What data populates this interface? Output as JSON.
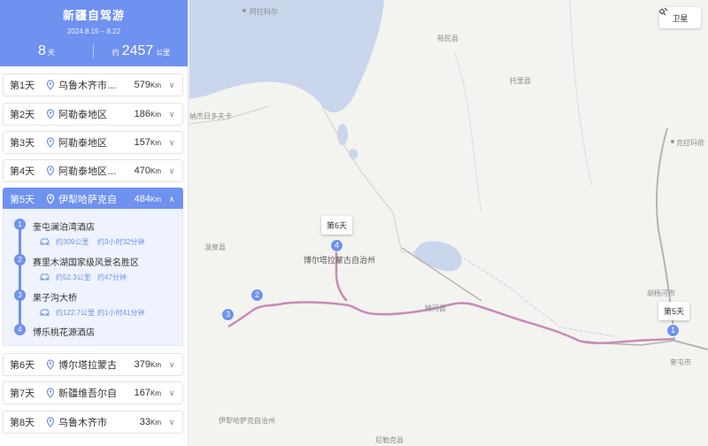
{
  "trip": {
    "title": "新疆自驾游",
    "dates": "2024.8.15 – 8.22",
    "days_num": "8",
    "days_unit": "天",
    "dist_prefix": "约",
    "dist_num": "2457",
    "dist_unit": "公里"
  },
  "days": [
    {
      "label": "第1天",
      "place": "乌鲁木齐市…",
      "km": "579",
      "unit": "Km"
    },
    {
      "label": "第2天",
      "place": "阿勒泰地区",
      "km": "186",
      "unit": "Km"
    },
    {
      "label": "第3天",
      "place": "阿勒泰地区",
      "km": "157",
      "unit": "Km"
    },
    {
      "label": "第4天",
      "place": "阿勒泰地区…",
      "km": "470",
      "unit": "Km"
    },
    {
      "label": "第5天",
      "place": "伊犁哈萨克自…",
      "km": "484",
      "unit": "Km"
    },
    {
      "label": "第6天",
      "place": "博尔塔拉蒙古…",
      "km": "379",
      "unit": "Km"
    },
    {
      "label": "第7天",
      "place": "新疆维吾尔自…",
      "km": "167",
      "unit": "Km"
    },
    {
      "label": "第8天",
      "place": "乌鲁木齐市",
      "km": "33",
      "unit": "Km"
    }
  ],
  "day5_detail": {
    "stops": [
      {
        "num": "1",
        "name": "奎屯澜泊湾酒店"
      },
      {
        "num": "2",
        "name": "赛里木湖国家级风景名胜区"
      },
      {
        "num": "3",
        "name": "果子沟大桥"
      },
      {
        "num": "4",
        "name": "博乐桃花源酒店"
      }
    ],
    "segments": [
      {
        "dist": "约309公里",
        "time": "约3小时32分钟"
      },
      {
        "dist": "约52.3公里",
        "time": "约47分钟"
      },
      {
        "dist": "约122.7公里",
        "time": "约1小时41分钟"
      }
    ]
  },
  "map": {
    "satellite_label": "卫星",
    "labels": {
      "alaker": "阿拉科尔",
      "yumin": "裕民县",
      "tuoli": "托里县",
      "ayagoz": "纳杰日多夫卡",
      "kelamayi": "克拉玛依",
      "wenquan": "温泉县",
      "bortala": "博尔塔拉蒙古自治州",
      "jinghe": "精河县",
      "hutubi": "胡杨河市",
      "kuitun": "奎屯市",
      "ili": "伊犁哈萨克自治州",
      "nileke": "尼勒克县"
    },
    "markers": [
      "1",
      "2",
      "3",
      "4"
    ],
    "tags": {
      "day6": "第6天",
      "day5": "第5天"
    }
  },
  "colors": {
    "accent": "#6f91f0",
    "route": "#c98bb5",
    "water": "#c9d6ec"
  }
}
